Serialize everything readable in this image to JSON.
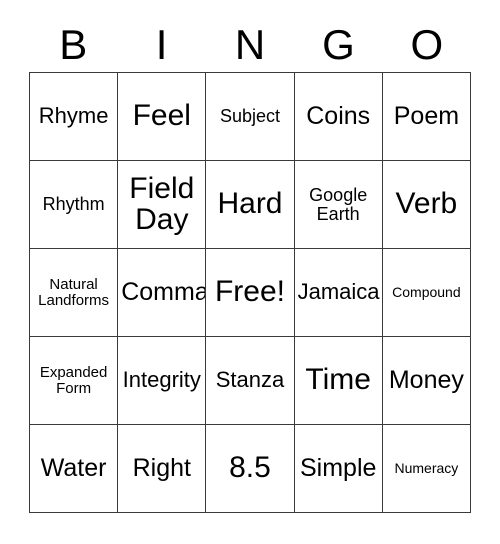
{
  "card": {
    "title": "BINGO",
    "header_letters": [
      "B",
      "I",
      "N",
      "G",
      "O"
    ],
    "free_space_label": "Free!",
    "colors": {
      "background": "#ffffff",
      "grid_line": "#3a3a3a",
      "text": "#000000"
    },
    "rows": [
      [
        {
          "text": "Rhyme",
          "size": "lg"
        },
        {
          "text": "Feel",
          "size": "xxl"
        },
        {
          "text": "Subject",
          "size": "md"
        },
        {
          "text": "Coins",
          "size": "xl"
        },
        {
          "text": "Poem",
          "size": "xl"
        }
      ],
      [
        {
          "text": "Rhythm",
          "size": "md"
        },
        {
          "text": "Field\nDay",
          "size": "xxl"
        },
        {
          "text": "Hard",
          "size": "xxl"
        },
        {
          "text": "Google\nEarth",
          "size": "md"
        },
        {
          "text": "Verb",
          "size": "xxl"
        }
      ],
      [
        {
          "text": "Natural\nLandforms",
          "size": "sm"
        },
        {
          "text": "Comma",
          "size": "xl"
        },
        {
          "text": "Free!",
          "size": "xxl"
        },
        {
          "text": "Jamaica",
          "size": "lg"
        },
        {
          "text": "Compound",
          "size": "xs"
        }
      ],
      [
        {
          "text": "Expanded\nForm",
          "size": "sm"
        },
        {
          "text": "Integrity",
          "size": "lg"
        },
        {
          "text": "Stanza",
          "size": "lg"
        },
        {
          "text": "Time",
          "size": "xxl"
        },
        {
          "text": "Money",
          "size": "xl"
        }
      ],
      [
        {
          "text": "Water",
          "size": "xl"
        },
        {
          "text": "Right",
          "size": "xl"
        },
        {
          "text": "8.5",
          "size": "xxl"
        },
        {
          "text": "Simple",
          "size": "xl"
        },
        {
          "text": "Numeracy",
          "size": "xs"
        }
      ]
    ]
  }
}
